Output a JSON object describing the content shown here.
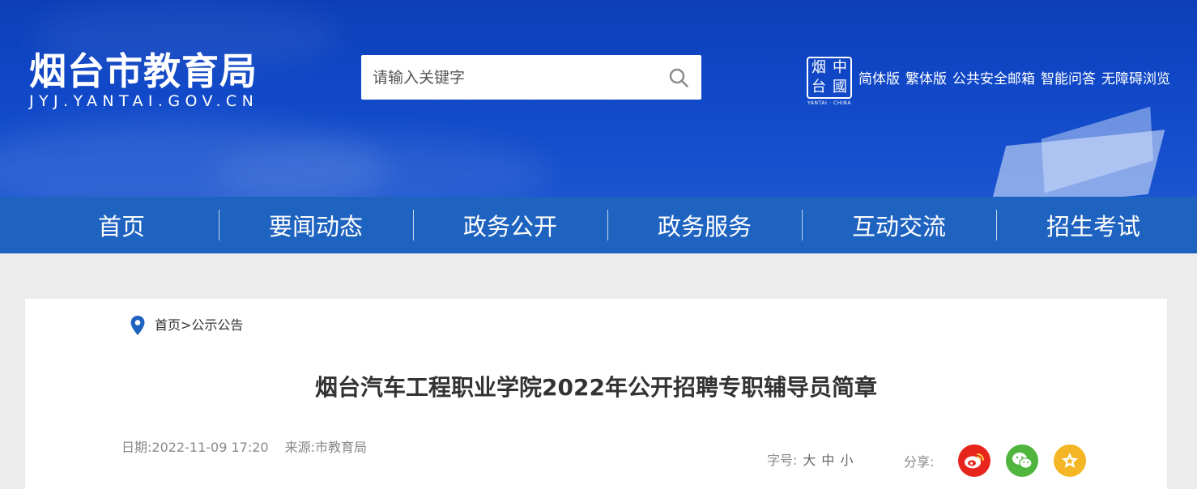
{
  "header": {
    "site_title": "烟台市教育局",
    "site_domain": "JYJ.YANTAI.GOV.CN",
    "search": {
      "placeholder": "请输入关键字",
      "icon": "search-icon"
    },
    "seal": {
      "chars": [
        "烟",
        "中",
        "台",
        "國"
      ],
      "caption": "YANTAI · CHINA"
    },
    "top_links": [
      "简体版",
      "繁体版",
      "公共安全邮箱",
      "智能问答",
      "无障碍浏览"
    ]
  },
  "nav": {
    "items": [
      "首页",
      "要闻动态",
      "政务公开",
      "政务服务",
      "互动交流",
      "招生考试"
    ]
  },
  "breadcrumb": {
    "icon": "location-pin-icon",
    "path": "首页>公示公告"
  },
  "article": {
    "title": "烟台汽车工程职业学院2022年公开招聘专职辅导员简章",
    "date": "日期:2022-11-09 17:20",
    "source": "来源:市教育局"
  },
  "fontsize": {
    "label": "字号:",
    "options": [
      "大",
      "中",
      "小"
    ]
  },
  "share": {
    "label": "分享:",
    "buttons": [
      {
        "name": "weibo",
        "icon": "weibo-icon",
        "color": "#e8251d"
      },
      {
        "name": "wechat",
        "icon": "wechat-icon",
        "color": "#4fb53d"
      },
      {
        "name": "favorite",
        "icon": "star-icon",
        "color": "#f5b626"
      }
    ]
  },
  "colors": {
    "banner": "#1048c8",
    "nav": "#1f63c0",
    "page_bg": "#ececec",
    "title_text": "#333333"
  }
}
